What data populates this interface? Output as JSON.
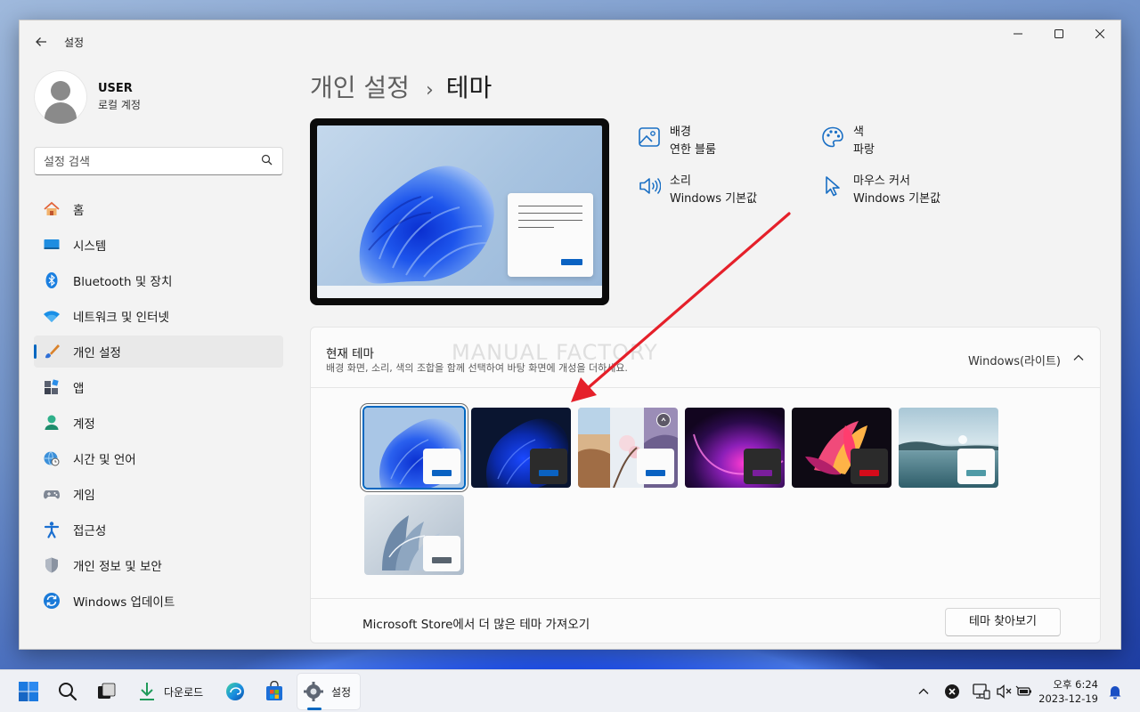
{
  "window": {
    "title": "설정",
    "back_icon": "back-arrow-icon",
    "controls": [
      "minimize-icon",
      "maximize-icon",
      "close-icon"
    ]
  },
  "profile": {
    "name": "USER",
    "account": "로컬 계정"
  },
  "search": {
    "placeholder": "설정 검색"
  },
  "sidebar": {
    "items": [
      {
        "label": "홈",
        "icon": "home-icon"
      },
      {
        "label": "시스템",
        "icon": "system-icon"
      },
      {
        "label": "Bluetooth 및 장치",
        "icon": "bluetooth-icon"
      },
      {
        "label": "네트워크 및 인터넷",
        "icon": "wifi-icon"
      },
      {
        "label": "개인 설정",
        "icon": "brush-icon",
        "active": true
      },
      {
        "label": "앱",
        "icon": "apps-icon"
      },
      {
        "label": "계정",
        "icon": "account-icon"
      },
      {
        "label": "시간 및 언어",
        "icon": "globe-clock-icon"
      },
      {
        "label": "게임",
        "icon": "gamepad-icon"
      },
      {
        "label": "접근성",
        "icon": "accessibility-icon"
      },
      {
        "label": "개인 정보 및 보안",
        "icon": "shield-icon"
      },
      {
        "label": "Windows 업데이트",
        "icon": "update-icon"
      }
    ]
  },
  "page": {
    "breadcrumb_parent": "개인 설정",
    "breadcrumb_sep": "›",
    "breadcrumb_current": "테마"
  },
  "theme_props": {
    "background": {
      "name": "배경",
      "value": "연한 블룸",
      "icon": "image-icon"
    },
    "color": {
      "name": "색",
      "value": "파랑",
      "icon": "palette-icon"
    },
    "sound": {
      "name": "소리",
      "value": "Windows 기본값",
      "icon": "speaker-icon"
    },
    "cursor": {
      "name": "마우스 커서",
      "value": "Windows 기본값",
      "icon": "cursor-icon"
    }
  },
  "current_theme": {
    "title": "현재 테마",
    "description": "배경 화면, 소리, 색의 조합을 함께 선택하여 바탕 화면에 개성을 더하세요.",
    "value": "Windows(라이트)",
    "watermark": "MANUAL FACTORY",
    "themes": [
      {
        "id": "windows-light",
        "selected": true,
        "accent": "#0a62c2",
        "mini_bg": "#fbfbfb"
      },
      {
        "id": "windows-dark",
        "selected": false,
        "accent": "#0a62c2",
        "mini_bg": "#2b2b2b"
      },
      {
        "id": "spotlight",
        "selected": false,
        "accent": "#0a62c2",
        "mini_bg": "#fbfbfb"
      },
      {
        "id": "glow",
        "selected": false,
        "accent": "#7a1e9c",
        "mini_bg": "#2b2b2b"
      },
      {
        "id": "captured-motion",
        "selected": false,
        "accent": "#d40b1a",
        "mini_bg": "#2b2b2b"
      },
      {
        "id": "sunrise",
        "selected": false,
        "accent": "#4f9aa6",
        "mini_bg": "#fbfbfb"
      },
      {
        "id": "flow",
        "selected": false,
        "accent": "#58636e",
        "mini_bg": "#fbfbfb"
      }
    ],
    "store_text": "Microsoft Store에서 더 많은 테마 가져오기",
    "store_button": "테마 찾아보기"
  },
  "taskbar": {
    "items": [
      {
        "label": "",
        "icon": "start-icon"
      },
      {
        "label": "",
        "icon": "search-icon"
      },
      {
        "label": "",
        "icon": "task-view-icon"
      },
      {
        "label": "다운로드",
        "icon": "download-icon"
      },
      {
        "label": "",
        "icon": "edge-icon"
      },
      {
        "label": "",
        "icon": "store-icon"
      },
      {
        "label": "설정",
        "icon": "settings-gear-icon",
        "active": true
      }
    ],
    "tray": {
      "time": "오후 6:24",
      "date": "2023-12-19"
    }
  },
  "colors": {
    "accent": "#0067c0",
    "annotation_arrow": "#e5202a"
  }
}
